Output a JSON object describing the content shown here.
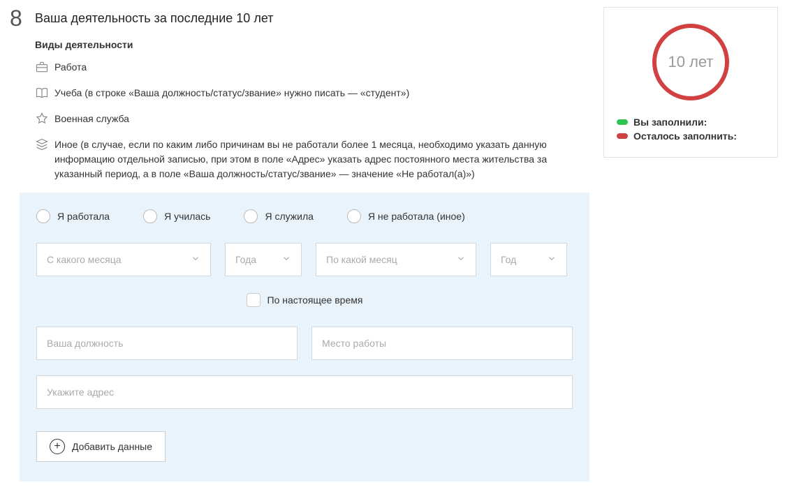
{
  "section": {
    "number": "8",
    "title": "Ваша деятельность за последние 10 лет",
    "subhead": "Виды деятельности"
  },
  "activityTypes": {
    "work": "Работа",
    "study": "Учеба (в строке «Ваша должность/статус/звание» нужно писать — «студент»)",
    "military": "Военная служба",
    "other": "Иное (в случае, если по каким либо причинам вы не работали более 1 месяца, необходимо указать данную информацию отдельной записью, при этом в поле «Адрес» указать адрес постоянного места жительства за указанный период, а в поле «Ваша должность/статус/звание» — значение «Не работал(а)»)"
  },
  "form": {
    "radios": {
      "worked": "Я работала",
      "studied": "Я училась",
      "served": "Я служила",
      "notWorked": "Я не работала (иное)"
    },
    "placeholders": {
      "fromMonth": "С какого месяца",
      "fromYear": "Года",
      "toMonth": "По какой месяц",
      "toYear": "Год",
      "position": "Ваша должность",
      "workplace": "Место работы",
      "address": "Укажите адрес"
    },
    "presentLabel": "По настоящее время",
    "addButton": "Добавить данные"
  },
  "sidebar": {
    "donutLabel": "10 лет",
    "filledLabel": "Вы заполнили:",
    "remainingLabel": "Осталось заполнить:"
  }
}
